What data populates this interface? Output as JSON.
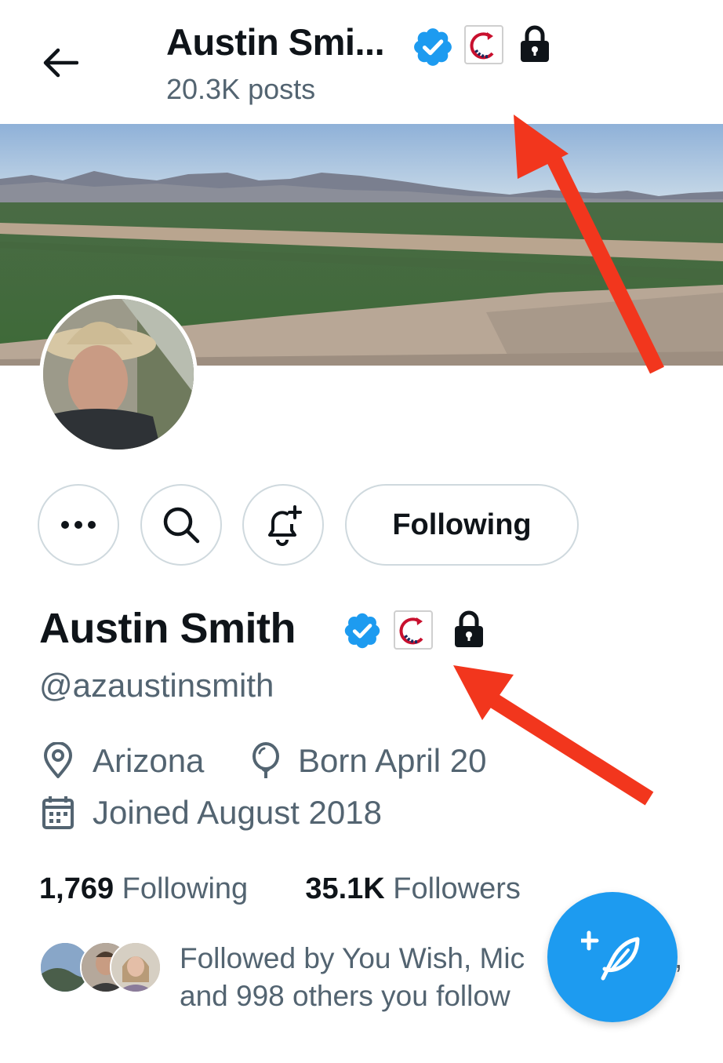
{
  "header": {
    "title": "Austin Smi...",
    "posts_count": "20.3K posts"
  },
  "actions": {
    "following_label": "Following"
  },
  "profile": {
    "display_name": "Austin Smith",
    "handle": "@azaustinsmith",
    "location": "Arizona",
    "birthday": "Born April 20",
    "joined": "Joined August 2018"
  },
  "stats": {
    "following_count": "1,769",
    "following_label": "Following",
    "followers_count": "35.1K",
    "followers_label": "Followers"
  },
  "followed_by": {
    "line1": "Followed by You Wish, Mic",
    "line2": "and 998 others you follow",
    "trailing_comma": ","
  },
  "colors": {
    "accent": "#1d9bf0",
    "annotation_arrow": "#f2361d",
    "secondary_text": "#536471"
  },
  "icons": {
    "back": "arrow-left-icon",
    "verified": "verified-badge-icon",
    "affiliate": "affiliate-logo-icon",
    "protected": "lock-icon",
    "more": "more-horizontal-icon",
    "search": "search-icon",
    "notifications": "bell-plus-icon",
    "location": "location-pin-icon",
    "birthday": "balloon-icon",
    "joined": "calendar-icon",
    "compose": "compose-feather-icon"
  }
}
